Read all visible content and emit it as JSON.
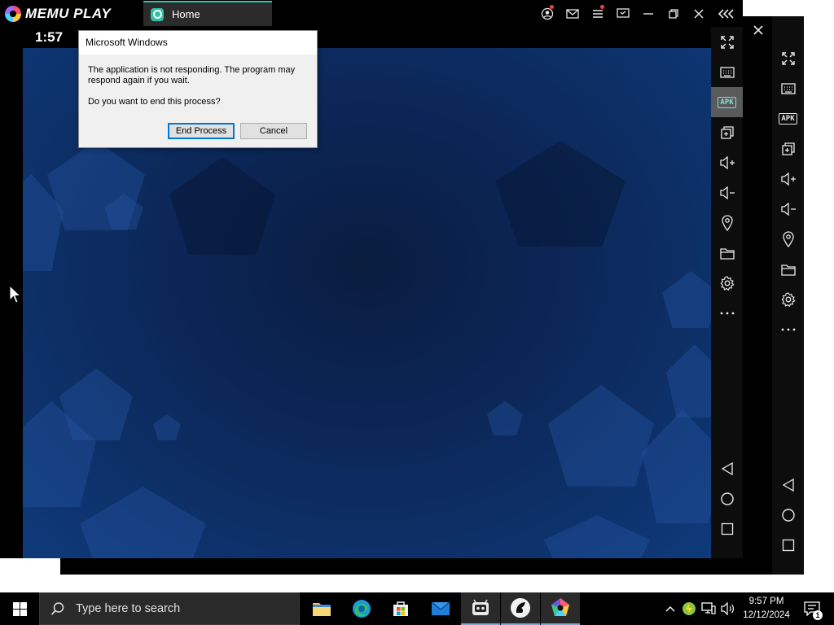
{
  "app": {
    "brand": "MEMU PLAY",
    "tab_label": "Home"
  },
  "android": {
    "clock": "1:57"
  },
  "dialog": {
    "title": "Microsoft Windows",
    "message": "The application is not responding. The program may respond again if you wait.",
    "question": "Do you want to end this process?",
    "end_label": "End Process",
    "cancel_label": "Cancel"
  },
  "sidebar": {
    "items": [
      {
        "icon": "fullscreen-icon"
      },
      {
        "icon": "keyboard-icon"
      },
      {
        "icon": "apk-icon",
        "label": "APK",
        "active": true
      },
      {
        "icon": "multi-window-icon"
      },
      {
        "icon": "volume-up-icon"
      },
      {
        "icon": "volume-down-icon"
      },
      {
        "icon": "location-icon"
      },
      {
        "icon": "folder-icon"
      },
      {
        "icon": "settings-gear-icon"
      },
      {
        "icon": "more-icon"
      }
    ],
    "nav": [
      "back-icon",
      "home-icon",
      "recents-icon"
    ]
  },
  "taskbar": {
    "search_placeholder": "Type here to search",
    "apps": [
      "file-explorer-icon",
      "edge-icon",
      "store-icon",
      "mail-icon",
      "memu-multi-icon",
      "app-icon",
      "memu-icon"
    ],
    "time": "9:57 PM",
    "date": "12/12/2024",
    "notification_count": "1"
  },
  "colors": {
    "accent": "#2fc0a6",
    "taskbar": "#000000",
    "wallpaper": "#0d3068"
  }
}
